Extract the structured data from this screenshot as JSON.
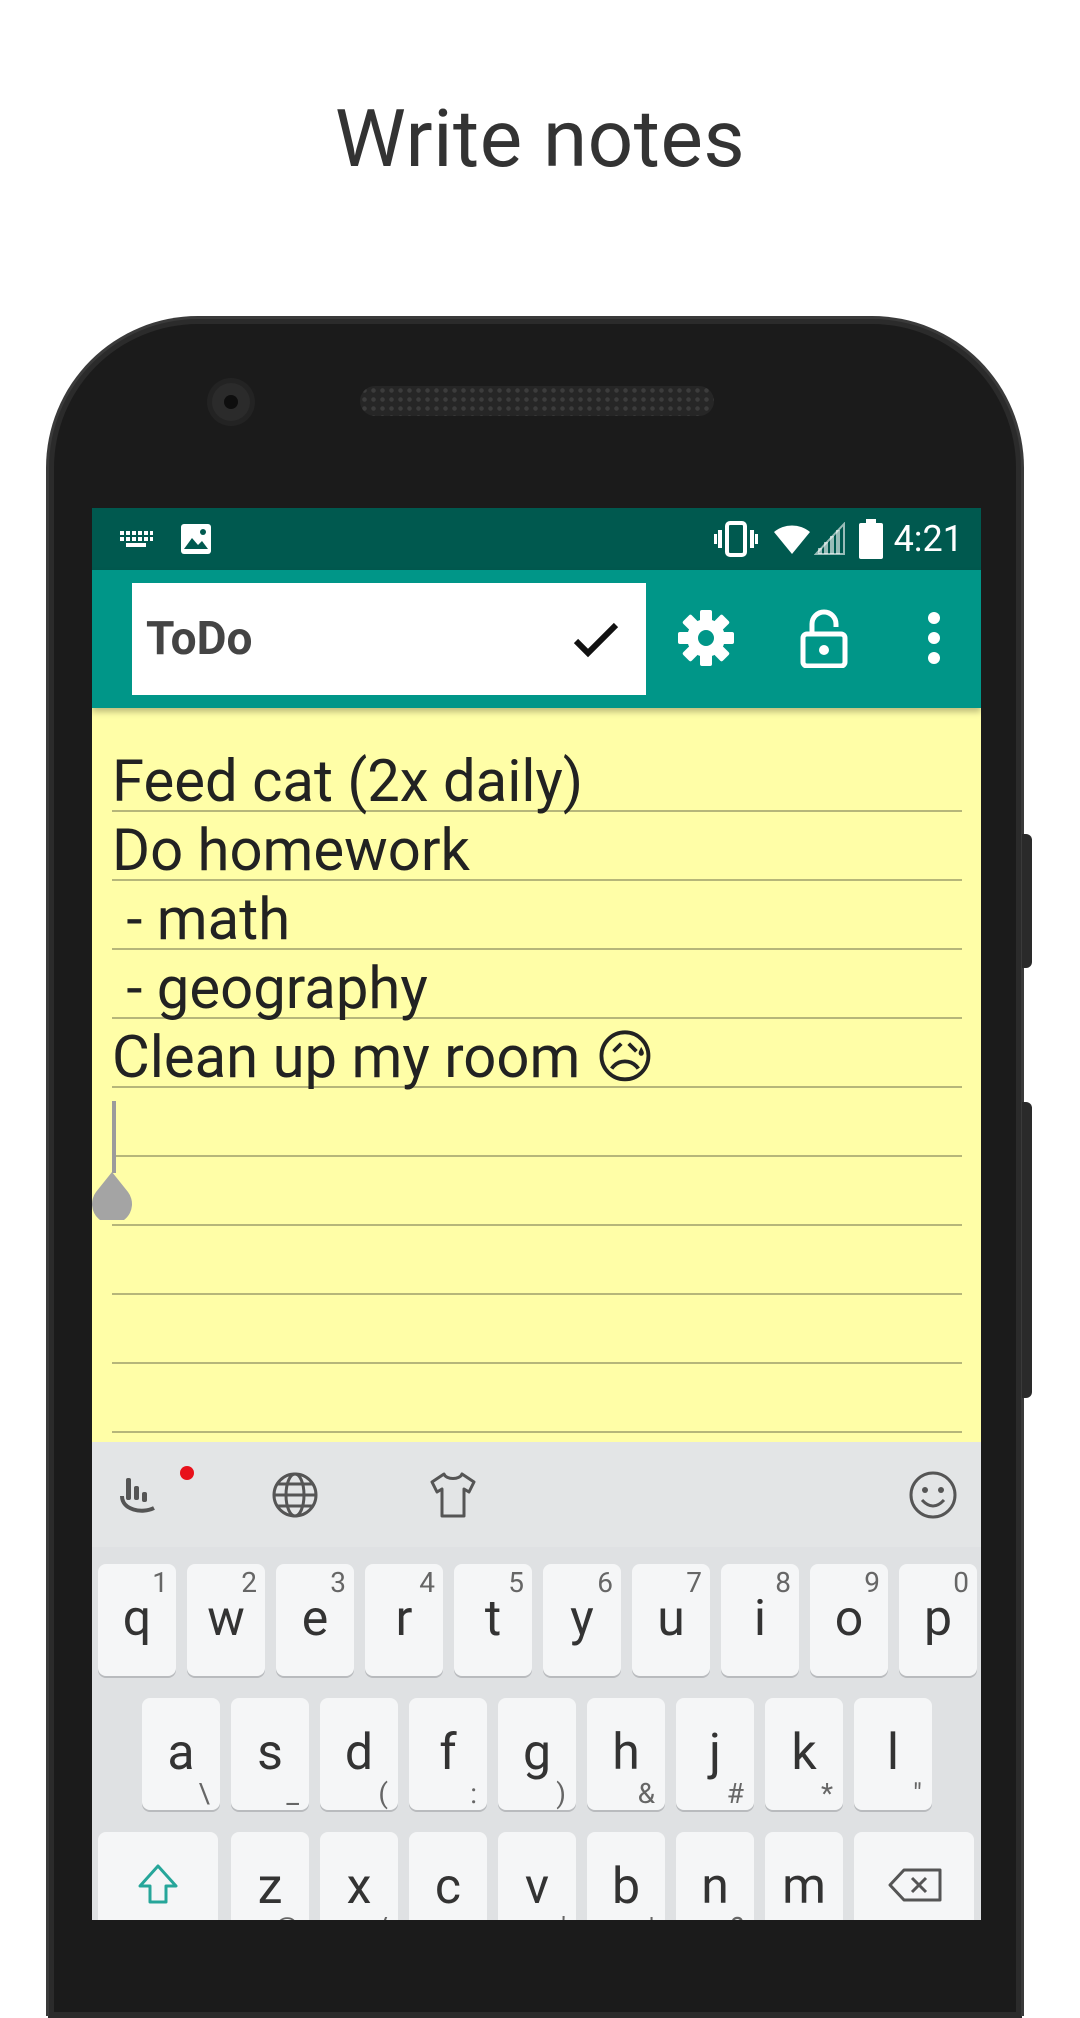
{
  "headline": "Write notes",
  "status_bar": {
    "time": "4:21",
    "left_icons": [
      "keyboard-icon",
      "image-icon"
    ],
    "right_icons": [
      "vibrate-icon",
      "wifi-icon",
      "signal-icon",
      "battery-icon"
    ]
  },
  "app_bar": {
    "title_value": "ToDo",
    "actions": [
      "check-icon",
      "gear-icon",
      "unlock-icon",
      "more-vert-icon"
    ]
  },
  "note": {
    "lines": [
      "Feed cat (2x daily)",
      "Do homework",
      " - math",
      " - geography",
      "Clean up my room"
    ],
    "emoji": "😥"
  },
  "keyboard": {
    "toolbar_icons": [
      "touchpal-icon",
      "globe-icon",
      "tshirt-icon",
      "smiley-icon"
    ],
    "row1": [
      {
        "main": "q",
        "sub": "1"
      },
      {
        "main": "w",
        "sub": "2"
      },
      {
        "main": "e",
        "sub": "3"
      },
      {
        "main": "r",
        "sub": "4"
      },
      {
        "main": "t",
        "sub": "5"
      },
      {
        "main": "y",
        "sub": "6"
      },
      {
        "main": "u",
        "sub": "7"
      },
      {
        "main": "i",
        "sub": "8"
      },
      {
        "main": "o",
        "sub": "9"
      },
      {
        "main": "p",
        "sub": "0"
      }
    ],
    "row2": [
      {
        "main": "a",
        "sub": "\\"
      },
      {
        "main": "s",
        "sub": "_"
      },
      {
        "main": "d",
        "sub": "("
      },
      {
        "main": "f",
        "sub": ":"
      },
      {
        "main": "g",
        "sub": ")"
      },
      {
        "main": "h",
        "sub": "&"
      },
      {
        "main": "j",
        "sub": "#"
      },
      {
        "main": "k",
        "sub": "*"
      },
      {
        "main": "l",
        "sub": "\""
      }
    ],
    "row3": [
      {
        "main": "z",
        "sub": "@"
      },
      {
        "main": "x",
        "sub": "/"
      },
      {
        "main": "c",
        "sub": "-"
      },
      {
        "main": "v",
        "sub": "'"
      },
      {
        "main": "b",
        "sub": "|"
      },
      {
        "main": "n",
        "sub": "?"
      },
      {
        "main": "m",
        "sub": ","
      }
    ]
  },
  "colors": {
    "status_bar": "#00594f",
    "app_bar": "#009688",
    "note_bg": "#fffea7",
    "keyboard_bg": "#dfe1e3"
  }
}
